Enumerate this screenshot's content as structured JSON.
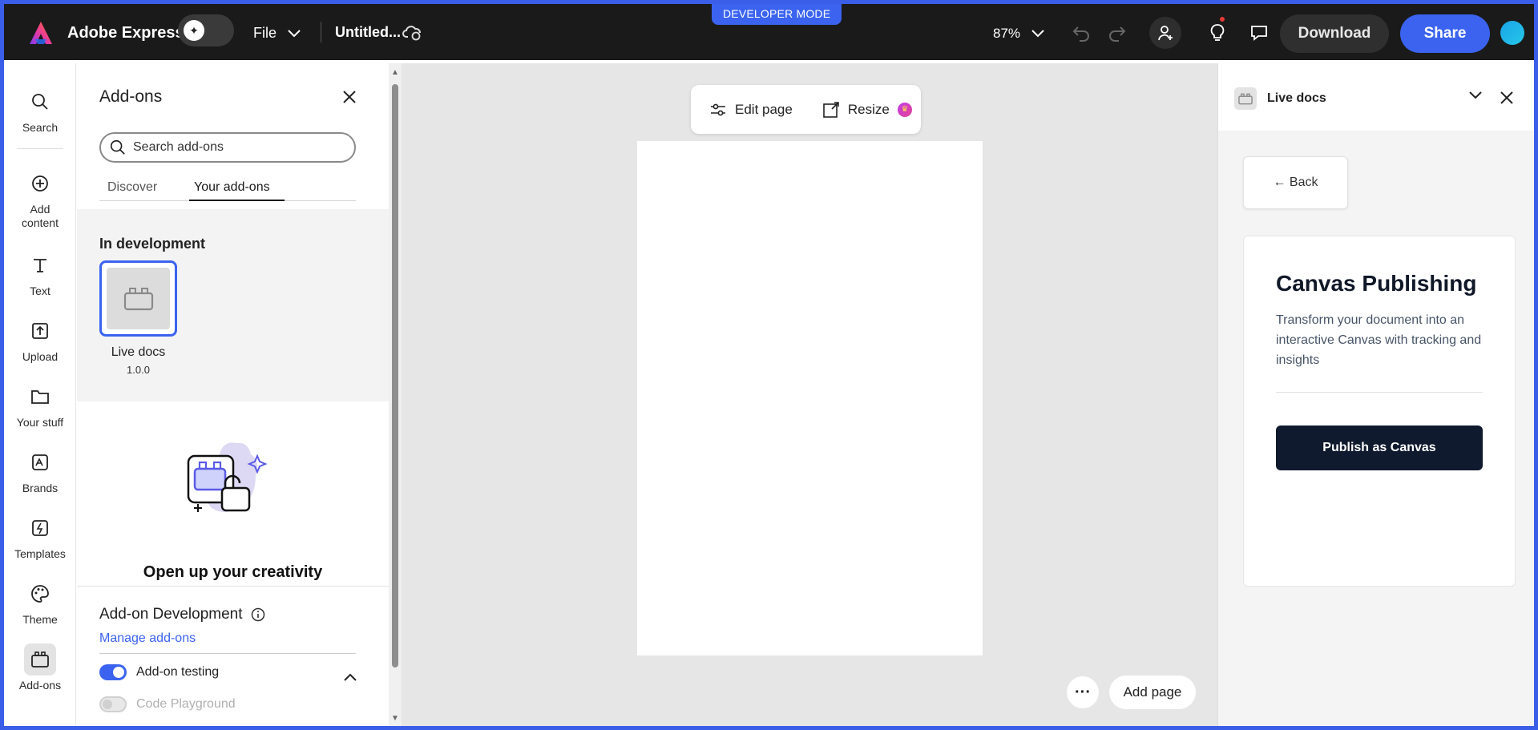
{
  "topbar": {
    "developer_mode": "DEVELOPER MODE",
    "brand": "Adobe Express",
    "file_menu": "File",
    "doc_title": "Untitled...",
    "zoom": "87%",
    "download": "Download",
    "share": "Share"
  },
  "rail": {
    "items": [
      {
        "label": "Search",
        "icon": "search-icon"
      },
      {
        "label": "Add content",
        "icon": "plus-circle-icon"
      },
      {
        "label": "Text",
        "icon": "text-icon"
      },
      {
        "label": "Upload",
        "icon": "upload-icon"
      },
      {
        "label": "Your stuff",
        "icon": "folder-icon"
      },
      {
        "label": "Brands",
        "icon": "brand-icon"
      },
      {
        "label": "Templates",
        "icon": "template-icon"
      },
      {
        "label": "Theme",
        "icon": "palette-icon"
      },
      {
        "label": "Add-ons",
        "icon": "addons-icon"
      }
    ]
  },
  "addons_panel": {
    "title": "Add-ons",
    "search_placeholder": "Search add-ons",
    "tabs": [
      "Discover",
      "Your add-ons"
    ],
    "active_tab": "Your add-ons",
    "in_development_heading": "In development",
    "addon": {
      "name": "Live docs",
      "version": "1.0.0"
    },
    "creativity_heading": "Open up your creativity",
    "dev_footer": {
      "title": "Add-on Development",
      "manage_link": "Manage add-ons",
      "addon_testing": "Add-on testing",
      "addon_testing_on": true,
      "code_playground": "Code Playground",
      "code_playground_on": false
    }
  },
  "canvas": {
    "edit_page": "Edit page",
    "resize": "Resize",
    "add_page": "Add page"
  },
  "right_panel": {
    "title": "Live docs",
    "back": "← Back",
    "card_title": "Canvas Publishing",
    "card_desc": "Transform your document into an interactive Canvas with tracking and insights",
    "publish_button": "Publish as Canvas"
  },
  "colors": {
    "accent": "#3b63f0",
    "topbar_bg": "#1a1a1a",
    "publish_bg": "#101a2e"
  }
}
